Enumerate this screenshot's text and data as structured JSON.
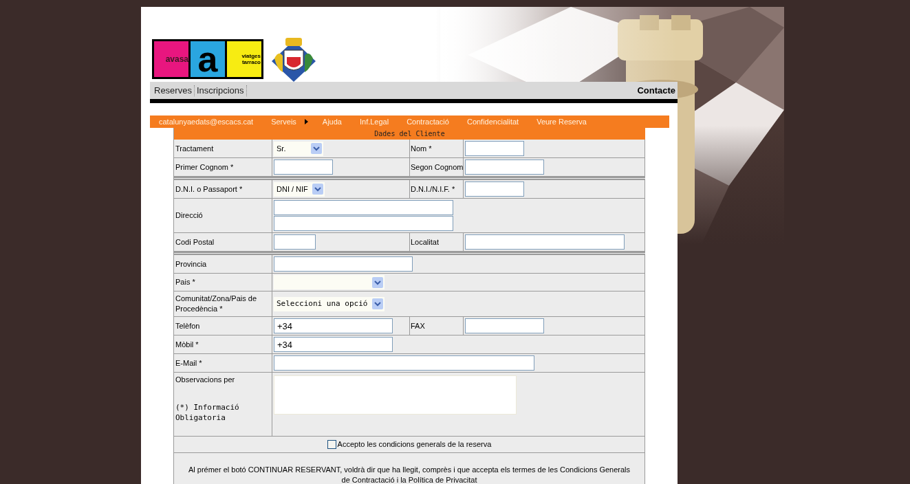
{
  "logo": {
    "left": "avasa",
    "middle": "a",
    "right": [
      "viatges",
      "tarraco"
    ]
  },
  "nav": {
    "items": [
      "Reserves",
      "Inscripcions"
    ],
    "right": "Contacte"
  },
  "menu": [
    {
      "label": "catalunyaedats@escacs.cat",
      "submenu": false
    },
    {
      "label": "Serveis",
      "submenu": true
    },
    {
      "label": "Ajuda",
      "submenu": false
    },
    {
      "label": "Inf.Legal",
      "submenu": false
    },
    {
      "label": "Contractació",
      "submenu": false
    },
    {
      "label": "Confidencialitat",
      "submenu": false
    },
    {
      "label": "Veure Reserva",
      "submenu": false
    }
  ],
  "form": {
    "title": "Dades del Cliente",
    "rows": [
      {
        "label": "Tractament",
        "fields": [
          {
            "kind": "select",
            "value": "Sr."
          }
        ],
        "label_2": "Nom *",
        "fields_2": [
          {
            "kind": "input"
          }
        ]
      },
      {
        "label": "Primer Cognom *",
        "fields": [
          {
            "kind": "input"
          }
        ],
        "label_2": "Segon Cognom",
        "fields_2": [
          {
            "kind": "input"
          }
        ]
      },
      {
        "label": "D.N.I. o Passaport *",
        "fields": [
          {
            "kind": "select",
            "value": "DNI / NIF"
          }
        ],
        "label_2": "D.N.I./N.I.F. *",
        "fields_2": [
          {
            "kind": "input"
          }
        ]
      },
      {
        "label": "Direcció",
        "fields": [
          {
            "kind": "input"
          },
          {
            "kind": "input"
          }
        ]
      },
      {
        "label": "Codi Postal",
        "fields": [
          {
            "kind": "input"
          }
        ],
        "label_2": "Localitat",
        "fields_2": [
          {
            "kind": "input"
          }
        ]
      },
      {
        "label": "Provincia",
        "fields": [
          {
            "kind": "input"
          }
        ]
      },
      {
        "label": "Pais *",
        "fields": [
          {
            "kind": "select"
          }
        ]
      },
      {
        "label": "Comunitat/Zona/Pais de Procedència *",
        "fields": [
          {
            "kind": "select",
            "value": "Seleccioni una opció"
          }
        ]
      },
      {
        "label": "Telèfon",
        "fields": [
          {
            "kind": "input",
            "value": "+34"
          }
        ],
        "label_2": "FAX",
        "fields_2": [
          {
            "kind": "input"
          }
        ]
      },
      {
        "label": "Mòbil *",
        "fields": [
          {
            "kind": "input",
            "value": "+34"
          }
        ]
      },
      {
        "label": "E-Mail *",
        "fields": [
          {
            "kind": "input"
          }
        ]
      },
      {
        "label": "Observacions per",
        "note": "(*) Informació Obligatoria",
        "fields": [
          {
            "kind": "textarea"
          }
        ]
      }
    ],
    "accept": {
      "label": "Accepto les condicions generals de la reserva",
      "checked": false
    },
    "terms": "Al prémer el botó CONTINUAR RESERVANT, voldrà dir que ha llegit, comprès i que accepta els termes de les Condicions Generals de Contractació i la Política de Privacitat"
  }
}
